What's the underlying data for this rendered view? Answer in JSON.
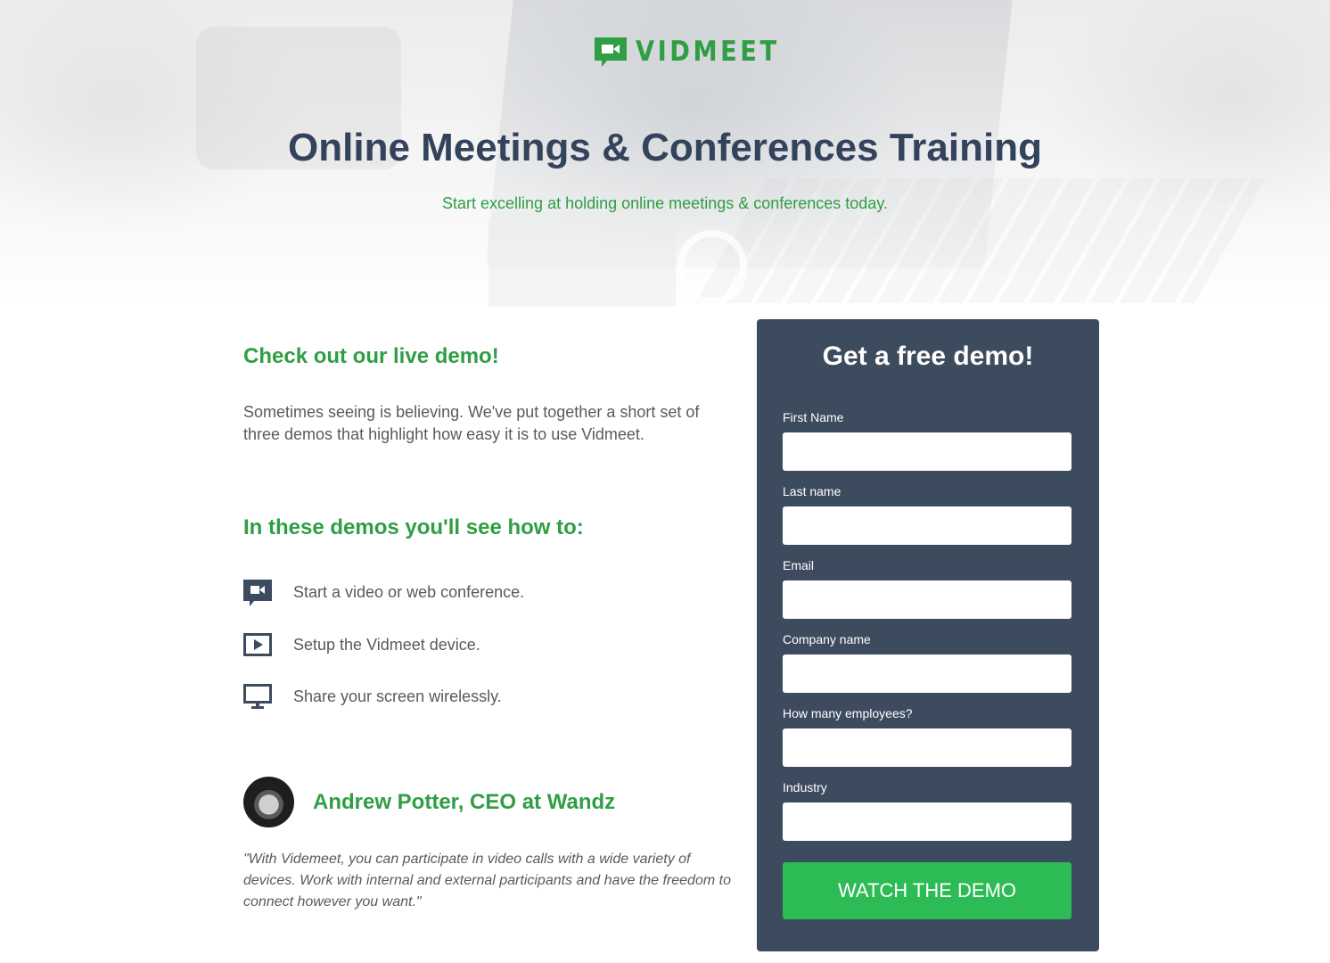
{
  "brand": {
    "name": "VIDMEET",
    "color": "#2f9e44",
    "icon": "video-chat-icon"
  },
  "hero": {
    "title": "Online Meetings & Conferences Training",
    "subtitle": "Start excelling at holding online meetings & conferences today."
  },
  "content": {
    "demo_heading": "Check out our live demo!",
    "intro": "Sometimes seeing is believing. We've put together a short set of three demos that highlight how easy it is to use Vidmeet.",
    "learn_heading": "In these demos you'll see how to:",
    "features": [
      {
        "icon": "video-chat-icon",
        "text": "Start a video or web conference."
      },
      {
        "icon": "play-icon",
        "text": "Setup the Vidmeet device."
      },
      {
        "icon": "monitor-icon",
        "text": "Share your screen wirelessly."
      }
    ]
  },
  "testimonial": {
    "name": "Andrew Potter, CEO at Wandz",
    "quote": "\"With Videmeet, you can participate in video calls with a wide variety of devices. Work with internal and external participants and have the freedom to connect however you want.\""
  },
  "form": {
    "title": "Get a free demo!",
    "panel_color": "#3d4b5e",
    "button_color": "#2cbb55",
    "fields": [
      {
        "label": "First Name",
        "value": ""
      },
      {
        "label": "Last name",
        "value": ""
      },
      {
        "label": "Email",
        "value": ""
      },
      {
        "label": "Company name",
        "value": ""
      },
      {
        "label": "How many employees?",
        "value": ""
      },
      {
        "label": "Industry",
        "value": ""
      }
    ],
    "submit_label": "WATCH THE DEMO"
  }
}
